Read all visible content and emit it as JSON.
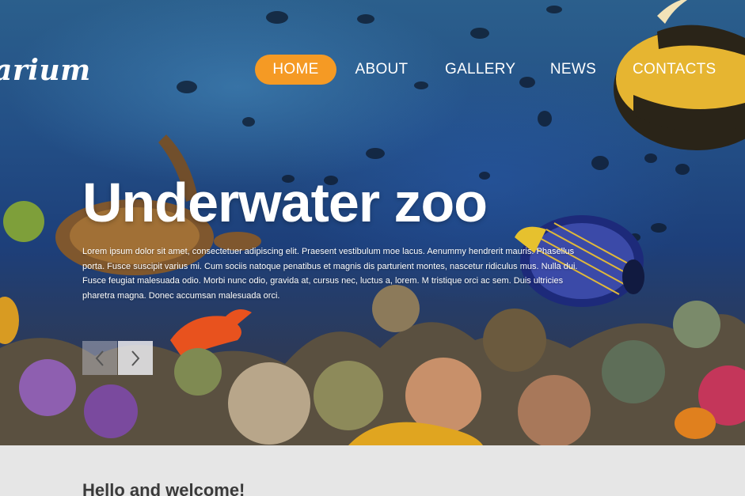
{
  "brand": {
    "logo_text": "arium"
  },
  "nav": {
    "items": [
      {
        "label": "HOME",
        "active": true
      },
      {
        "label": "ABOUT",
        "active": false
      },
      {
        "label": "GALLERY",
        "active": false
      },
      {
        "label": "NEWS",
        "active": false
      },
      {
        "label": "CONTACTS",
        "active": false
      }
    ]
  },
  "hero": {
    "title": "Underwater zoo",
    "text": "Lorem ipsum dolor sit amet, consectetuer adipiscing elit. Praesent vestibulum moe lacus. Aenummy hendrerit mauris. Phasellus porta. Fusce suscipit varius mi. Cum sociis natoque penatibus et magnis dis parturient montes, nascetur ridiculus mus. Nulla dui. Fusce feugiat malesuada odio. Morbi nunc odio, gravida at, cursus nec, luctus a, lorem. M tristique orci ac sem. Duis ultricies pharetra magna. Donec accumsan malesuada orci.",
    "prev_icon": "chevron-left-icon",
    "next_icon": "chevron-right-icon"
  },
  "welcome": {
    "title": "Hello and welcome!"
  },
  "colors": {
    "accent": "#f59a24",
    "hero_blue": "#234f86",
    "welcome_bg": "#e6e6e6"
  }
}
